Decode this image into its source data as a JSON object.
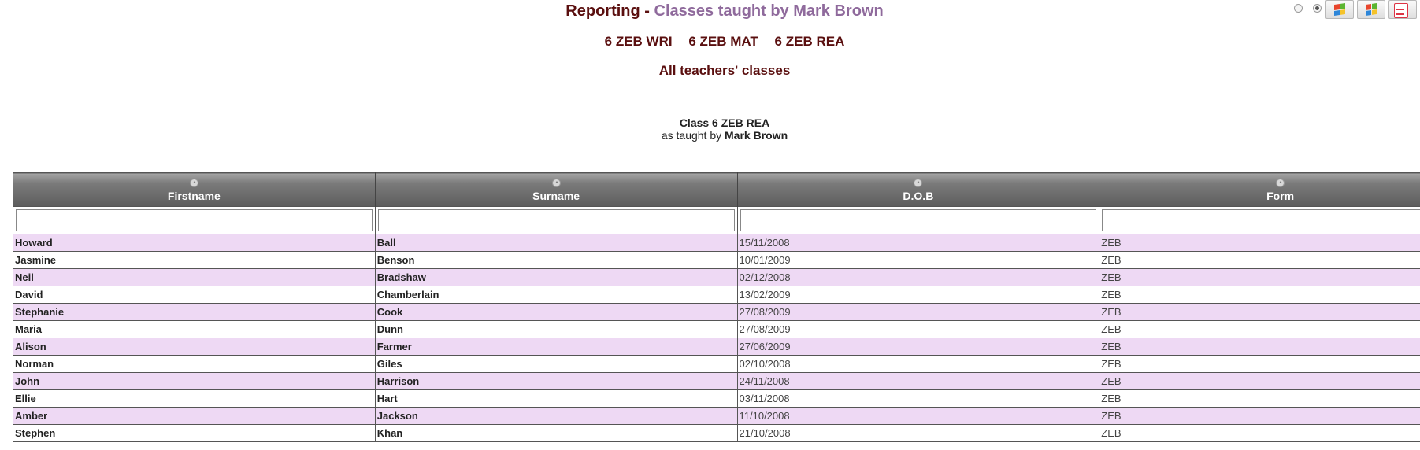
{
  "header": {
    "title_prefix": "Reporting - ",
    "title_sub": "Classes taught by Mark Brown",
    "class_links": [
      "6 ZEB WRI",
      "6 ZEB MAT",
      "6 ZEB REA"
    ],
    "all_classes_link": "All teachers' classes"
  },
  "class_info": {
    "class_label": "Class 6 ZEB REA",
    "taught_prefix": "as taught by ",
    "teacher": "Mark Brown"
  },
  "toolbar": {
    "icons": [
      "radio-unselected-icon",
      "radio-selected-icon",
      "excel-export-icon",
      "word-export-icon",
      "pdf-export-icon"
    ],
    "view_mode_selected": 1
  },
  "table": {
    "columns": [
      "Firstname",
      "Surname",
      "D.O.B",
      "Form"
    ],
    "filters": [
      "",
      "",
      "",
      ""
    ],
    "rows": [
      [
        "Howard",
        "Ball",
        "15/11/2008",
        "ZEB"
      ],
      [
        "Jasmine",
        "Benson",
        "10/01/2009",
        "ZEB"
      ],
      [
        "Neil",
        "Bradshaw",
        "02/12/2008",
        "ZEB"
      ],
      [
        "David",
        "Chamberlain",
        "13/02/2009",
        "ZEB"
      ],
      [
        "Stephanie",
        "Cook",
        "27/08/2009",
        "ZEB"
      ],
      [
        "Maria",
        "Dunn",
        "27/08/2009",
        "ZEB"
      ],
      [
        "Alison",
        "Farmer",
        "27/06/2009",
        "ZEB"
      ],
      [
        "Norman",
        "Giles",
        "02/10/2008",
        "ZEB"
      ],
      [
        "John",
        "Harrison",
        "24/11/2008",
        "ZEB"
      ],
      [
        "Ellie",
        "Hart",
        "03/11/2008",
        "ZEB"
      ],
      [
        "Amber",
        "Jackson",
        "11/10/2008",
        "ZEB"
      ],
      [
        "Stephen",
        "Khan",
        "21/10/2008",
        "ZEB"
      ]
    ]
  },
  "colors": {
    "title": "#5a0f0f",
    "title_sub": "#8f6a9c",
    "row_alt": "#eed9f4",
    "header_bg": "#6a6a6a"
  }
}
